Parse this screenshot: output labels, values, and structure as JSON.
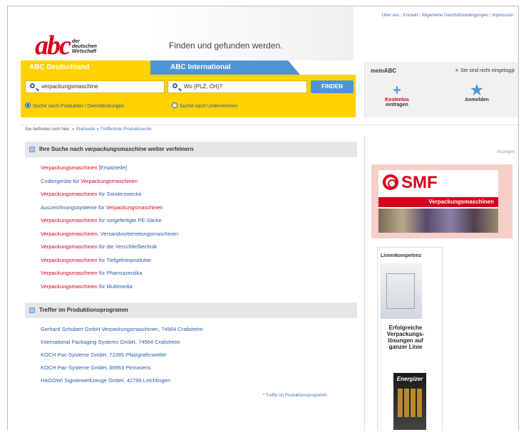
{
  "top_links": [
    "Über uns",
    "Kontakt",
    "Allgemeine Geschäftsbedingungen",
    "Impressum"
  ],
  "logo": {
    "main": "abc",
    "line1": "der",
    "line2": "deutschen",
    "line3": "Wirtschaft"
  },
  "tagline": "Finden und gefunden werden.",
  "tabs": {
    "de": "ABC Deutschland",
    "int": "ABC International"
  },
  "search": {
    "query": "verpackungsmaschine",
    "location_placeholder": "Wo (PLZ, Ort)?",
    "find_button": "FINDEN",
    "radio_products": "Suche nach Produkten / Dienstleistungen",
    "radio_companies": "Suche nach Unternehmen"
  },
  "meinabc": {
    "title": "meinABC",
    "status": "Sie sind nicht eingeloggt",
    "register_line1": "Kostenlos",
    "register_line2": "eintragen",
    "login": "Anmelden"
  },
  "breadcrumb": {
    "prefix": "Sie befinden sich hier:",
    "home": "» Startseite",
    "current": "» Trefferliste Produktsuche"
  },
  "refine": {
    "head_pre": "Ihre Suche nach ",
    "head_term": "verpackungsmaschine",
    "head_post": " weiter verfeinern",
    "items": [
      {
        "a": "",
        "hl": "Verpackungsmaschinen",
        "b": " [Ersatzteile]"
      },
      {
        "a": "Codiergeräte für ",
        "hl": "Verpackungsmaschinen",
        "b": ""
      },
      {
        "a": "",
        "hl": "Verpackungsmaschinen",
        "b": " für Sonderzwecke"
      },
      {
        "a": "Auszeichnungssysteme für ",
        "hl": "Verpackungsmaschinen",
        "b": ""
      },
      {
        "a": "",
        "hl": "Verpackungsmaschinen",
        "b": " für vorgefertigte PE-Säcke"
      },
      {
        "a": "",
        "hl": "Verpackungsmaschinen",
        "b": ", Versandvorbereitungsmaschinen"
      },
      {
        "a": "",
        "hl": "Verpackungsmaschinen",
        "b": " für die Verschließtechnik"
      },
      {
        "a": "",
        "hl": "Verpackungsmaschinen",
        "b": " für Tiefgefrierprodukte"
      },
      {
        "a": "",
        "hl": "Verpackungsmaschinen",
        "b": " für Pharmazeutika"
      },
      {
        "a": "",
        "hl": "Verpackungsmaschinen",
        "b": " für Multimedia"
      }
    ]
  },
  "treffer": {
    "head": "Treffer im Produktionsprogramm",
    "items": [
      "Gerhard Schubert GmbH Verpackungsmaschinen, 74564 Crailsheim",
      "International Packaging Systems GmbH, 74564 Crailsheim",
      "KOCH Pac-Systeme GmbH, 72285 Pfalzgrafenweiler",
      "KOCH Pac-Systeme GmbH, 66953 Pirmasens",
      "HAGOWI Signierwerkzeuge GmbH, 42799 Leichlingen"
    ],
    "more": "* Treffer im Produktionsprogramm"
  },
  "ads": {
    "label": "Anzeigen",
    "smf_logo": "SMF",
    "smf_tagline": "Verpackungsmaschinen",
    "sky_title": "Linienkompetenz",
    "sky_text": "Erfolgreiche Verpackungs-lösungen auf ganzer Linie",
    "sky_brand": "Energizer"
  }
}
